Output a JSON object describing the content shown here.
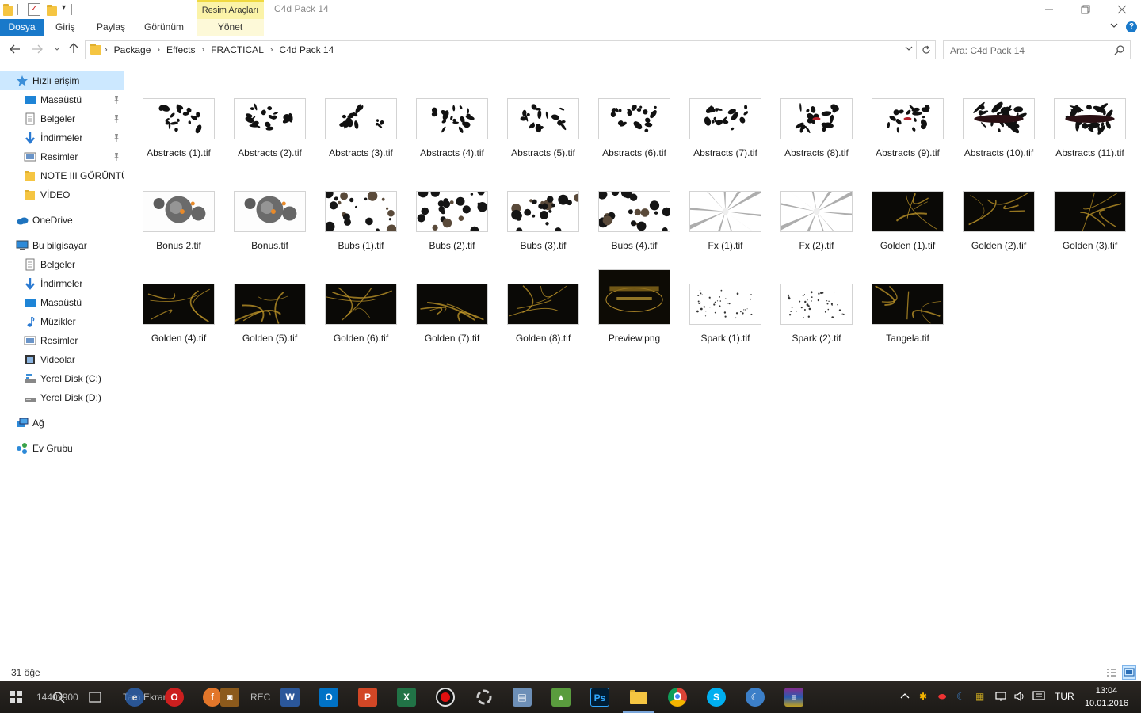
{
  "window": {
    "title": "C4d Pack 14",
    "contextual_tab_group": "Resim Araçları"
  },
  "ribbon": {
    "tabs": [
      {
        "label": "Dosya"
      },
      {
        "label": "Giriş"
      },
      {
        "label": "Paylaş"
      },
      {
        "label": "Görünüm"
      },
      {
        "label": "Yönet"
      }
    ]
  },
  "address": {
    "breadcrumbs": [
      "Package",
      "Effects",
      "FRACTICAL",
      "C4d Pack 14"
    ],
    "search_placeholder": "Ara: C4d Pack 14"
  },
  "sidebar": {
    "items": [
      {
        "label": "Hızlı erişim",
        "icon": "star-icon",
        "selected": true
      },
      {
        "label": "Masaüstü",
        "icon": "desktop-icon",
        "pinned": true
      },
      {
        "label": "Belgeler",
        "icon": "document-icon",
        "pinned": true
      },
      {
        "label": "İndirmeler",
        "icon": "download-icon",
        "pinned": true
      },
      {
        "label": "Resimler",
        "icon": "pictures-icon",
        "pinned": true
      },
      {
        "label": "NOTE III GÖRÜNTÜLERİ",
        "icon": "folder-icon"
      },
      {
        "label": "VİDEO",
        "icon": "folder-icon"
      },
      {
        "label": "OneDrive",
        "icon": "cloud-icon"
      },
      {
        "label": "Bu bilgisayar",
        "icon": "computer-icon"
      },
      {
        "label": "Belgeler",
        "icon": "document-icon"
      },
      {
        "label": "İndirmeler",
        "icon": "download-icon"
      },
      {
        "label": "Masaüstü",
        "icon": "desktop-icon"
      },
      {
        "label": "Müzikler",
        "icon": "music-icon"
      },
      {
        "label": "Resimler",
        "icon": "pictures-icon"
      },
      {
        "label": "Videolar",
        "icon": "video-icon"
      },
      {
        "label": "Yerel Disk (C:)",
        "icon": "drive-c-icon"
      },
      {
        "label": "Yerel Disk (D:)",
        "icon": "drive-icon"
      },
      {
        "label": "Ağ",
        "icon": "network-icon"
      },
      {
        "label": "Ev Grubu",
        "icon": "homegroup-icon"
      }
    ]
  },
  "files": [
    {
      "name": "Abstracts (1).tif",
      "style": "ink"
    },
    {
      "name": "Abstracts (2).tif",
      "style": "ink"
    },
    {
      "name": "Abstracts (3).tif",
      "style": "ink"
    },
    {
      "name": "Abstracts (4).tif",
      "style": "ink"
    },
    {
      "name": "Abstracts (5).tif",
      "style": "ink"
    },
    {
      "name": "Abstracts (6).tif",
      "style": "ink"
    },
    {
      "name": "Abstracts (7).tif",
      "style": "ink"
    },
    {
      "name": "Abstracts (8).tif",
      "style": "inkred"
    },
    {
      "name": "Abstracts (9).tif",
      "style": "inkred"
    },
    {
      "name": "Abstracts (10).tif",
      "style": "inkdark"
    },
    {
      "name": "Abstracts (11).tif",
      "style": "inkdark"
    },
    {
      "name": "Bonus 2.tif",
      "style": "spheres"
    },
    {
      "name": "Bonus.tif",
      "style": "spheres"
    },
    {
      "name": "Bubs (1).tif",
      "style": "bubbles"
    },
    {
      "name": "Bubs (2).tif",
      "style": "bubbles"
    },
    {
      "name": "Bubs (3).tif",
      "style": "bubbles"
    },
    {
      "name": "Bubs (4).tif",
      "style": "bubbles"
    },
    {
      "name": "Fx (1).tif",
      "style": "fx"
    },
    {
      "name": "Fx (2).tif",
      "style": "fx"
    },
    {
      "name": "Golden (1).tif",
      "style": "golden"
    },
    {
      "name": "Golden (2).tif",
      "style": "golden"
    },
    {
      "name": "Golden (3).tif",
      "style": "golden"
    },
    {
      "name": "Golden (4).tif",
      "style": "golden"
    },
    {
      "name": "Golden (5).tif",
      "style": "golden"
    },
    {
      "name": "Golden (6).tif",
      "style": "golden"
    },
    {
      "name": "Golden (7).tif",
      "style": "golden"
    },
    {
      "name": "Golden (8).tif",
      "style": "golden"
    },
    {
      "name": "Preview.png",
      "style": "preview"
    },
    {
      "name": "Spark (1).tif",
      "style": "spark"
    },
    {
      "name": "Spark (2).tif",
      "style": "spark"
    },
    {
      "name": "Tangela.tif",
      "style": "golden"
    }
  ],
  "status": {
    "item_count": "31 öğe"
  },
  "taskbar": {
    "overlay_resolution": "1440x900",
    "overlay_fullscreen": "Tam Ekran",
    "overlay_rec": "REC",
    "language": "TUR",
    "time": "13:04",
    "date": "10.01.2016"
  },
  "colors": {
    "accent": "#1979ca",
    "selection": "#cce8ff",
    "tool_tab": "#fbf3a8"
  }
}
